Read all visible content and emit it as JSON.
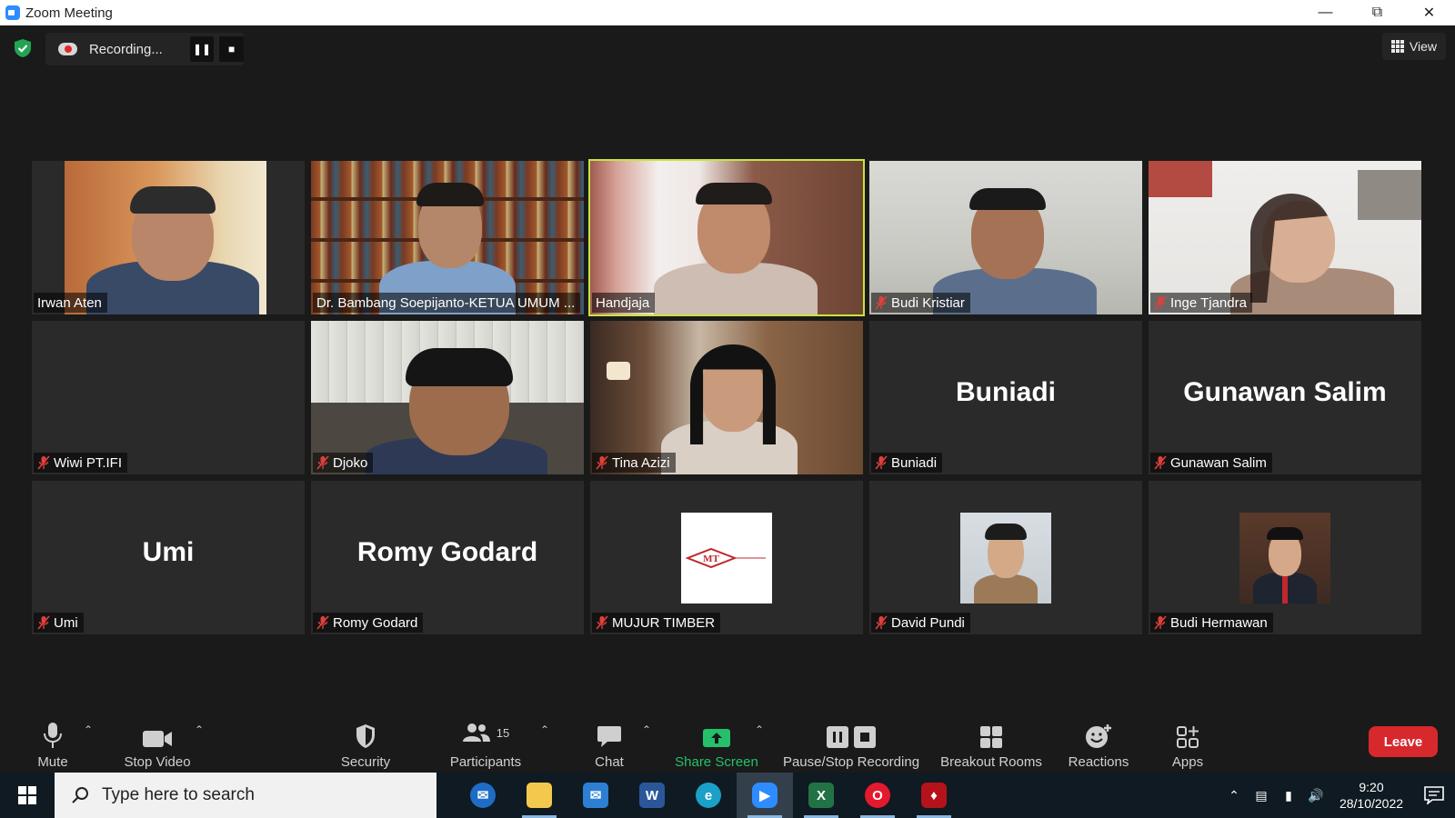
{
  "window": {
    "title": "Zoom Meeting"
  },
  "recording": {
    "status": "Recording..."
  },
  "view": {
    "label": "View"
  },
  "tiles": [
    {
      "name": "Irwan Aten",
      "muted": false,
      "video": true
    },
    {
      "name": "Dr. Bambang Soepijanto-KETUA UMUM ...",
      "muted": false,
      "video": true
    },
    {
      "name": "Handjaja",
      "muted": false,
      "video": true,
      "active_speaker": true
    },
    {
      "name": "Budi Kristiar",
      "muted": true,
      "video": true
    },
    {
      "name": "Inge Tjandra",
      "muted": true,
      "video": true
    },
    {
      "name": "Wiwi PT.IFI",
      "muted": true,
      "video": false
    },
    {
      "name": "Djoko",
      "muted": true,
      "video": true
    },
    {
      "name": "Tina Azizi",
      "muted": true,
      "video": true
    },
    {
      "name": "Buniadi",
      "muted": true,
      "video": false,
      "display_name": "Buniadi"
    },
    {
      "name": "Gunawan Salim",
      "muted": true,
      "video": false,
      "display_name": "Gunawan Salim"
    },
    {
      "name": "Umi",
      "muted": true,
      "video": false,
      "display_name": "Umi"
    },
    {
      "name": "Romy Godard",
      "muted": true,
      "video": false,
      "display_name": "Romy Godard"
    },
    {
      "name": "MUJUR TIMBER",
      "muted": true,
      "video": false,
      "profile_picture": true,
      "logo_text": "MT"
    },
    {
      "name": "David Pundi",
      "muted": true,
      "video": false,
      "profile_picture": true
    },
    {
      "name": "Budi Hermawan",
      "muted": true,
      "video": false,
      "profile_picture": true
    }
  ],
  "toolbar": {
    "mute": "Mute",
    "stop_video": "Stop Video",
    "security": "Security",
    "participants": "Participants",
    "participants_count": "15",
    "chat": "Chat",
    "share_screen": "Share Screen",
    "pause_stop_recording": "Pause/Stop Recording",
    "breakout_rooms": "Breakout Rooms",
    "reactions": "Reactions",
    "apps": "Apps",
    "leave": "Leave"
  },
  "taskbar": {
    "search_placeholder": "Type here to search",
    "time": "9:20",
    "date": "28/10/2022",
    "apps": [
      "outlook",
      "file-explorer",
      "mail",
      "word",
      "edge",
      "zoom",
      "excel",
      "opera",
      "game"
    ]
  },
  "colors": {
    "active_speaker": "#c5e63e",
    "share_green": "#24c16a",
    "leave_red": "#d7282d",
    "mute_red": "#e0403a"
  }
}
